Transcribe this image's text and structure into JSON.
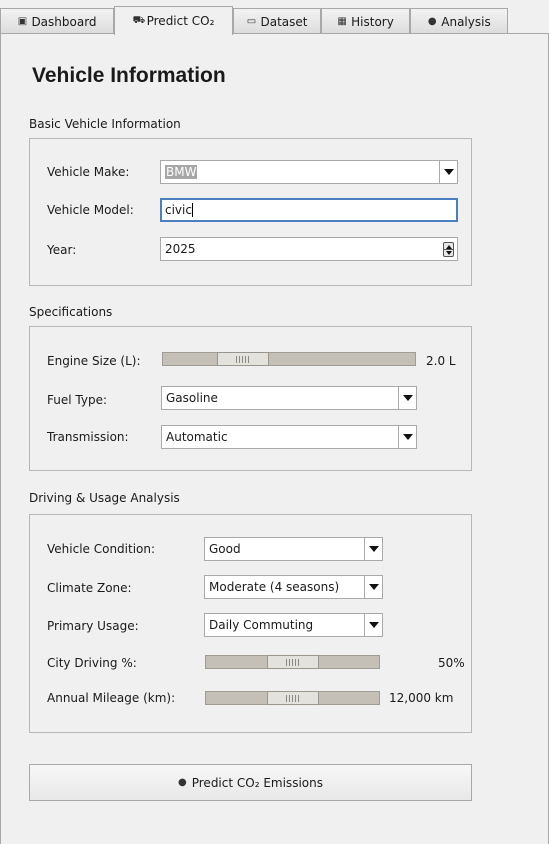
{
  "tabs": [
    {
      "label": "Dashboard",
      "icon": "dashboard-icon",
      "glyph": "▣"
    },
    {
      "label": "Predict CO₂",
      "icon": "car-icon",
      "glyph": "⛟"
    },
    {
      "label": "Dataset",
      "icon": "folder-icon",
      "glyph": "▭"
    },
    {
      "label": "History",
      "icon": "calendar-icon",
      "glyph": "▦"
    },
    {
      "label": "Analysis",
      "icon": "magnifier-icon",
      "glyph": "●"
    }
  ],
  "active_tab": "Predict CO₂",
  "page_title": "Vehicle Information",
  "basic": {
    "title": "Basic Vehicle Information",
    "make_label": "Vehicle Make:",
    "make_value": "BMW",
    "model_label": "Vehicle Model:",
    "model_value": "civic",
    "year_label": "Year:",
    "year_value": "2025"
  },
  "specs": {
    "title": "Specifications",
    "engine_label": "Engine Size (L):",
    "engine_value": "2.0 L",
    "engine_slider_fraction": 0.27,
    "fuel_label": "Fuel Type:",
    "fuel_value": "Gasoline",
    "transmission_label": "Transmission:",
    "transmission_value": "Automatic"
  },
  "driving": {
    "title": "Driving & Usage Analysis",
    "condition_label": "Vehicle Condition:",
    "condition_value": "Good",
    "climate_label": "Climate Zone:",
    "climate_value": "Moderate (4 seasons)",
    "usage_label": "Primary Usage:",
    "usage_value": "Daily Commuting",
    "city_label": "City Driving %:",
    "city_value": "50%",
    "city_slider_fraction": 0.5,
    "mileage_label": "Annual Mileage (km):",
    "mileage_value": "12,000 km",
    "mileage_slider_fraction": 0.5
  },
  "predict_button": {
    "label": "Predict CO₂ Emissions",
    "icon": "magnifier-icon",
    "glyph": "●"
  },
  "colors": {
    "focus_border": "#4a7fc1",
    "selection_bg": "#a7a7a7"
  }
}
